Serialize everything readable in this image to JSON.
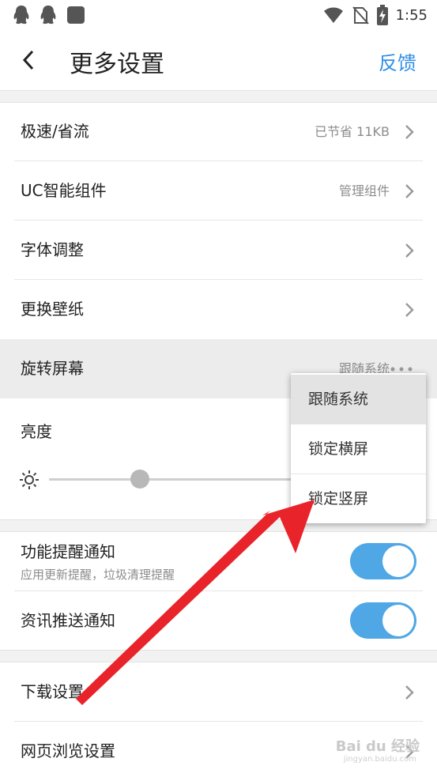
{
  "status_bar": {
    "time": "1:55",
    "left_icons": [
      "qq-icon",
      "qq-icon",
      "app-square-icon"
    ],
    "right_icons": [
      "wifi-icon",
      "no-sim-icon",
      "battery-charging-icon"
    ]
  },
  "header": {
    "title": "更多设置",
    "feedback": "反馈"
  },
  "settings": {
    "speed": {
      "label": "极速/省流",
      "value": "已节省 11KB"
    },
    "widget": {
      "label": "UC智能组件",
      "value": "管理组件"
    },
    "font": {
      "label": "字体调整"
    },
    "wallpaper": {
      "label": "更换壁纸"
    },
    "rotate": {
      "label": "旋转屏幕",
      "value": "跟随系统"
    },
    "brightness": {
      "label": "亮度",
      "level_fraction": 0.36
    },
    "feature_notify": {
      "label": "功能提醒通知",
      "subtitle": "应用更新提醒，垃圾清理提醒",
      "enabled": true
    },
    "news_notify": {
      "label": "资讯推送通知",
      "enabled": true
    },
    "download": {
      "label": "下载设置"
    },
    "browse": {
      "label": "网页浏览设置"
    }
  },
  "rotate_menu": {
    "options": [
      "跟随系统",
      "锁定横屏",
      "锁定竖屏"
    ],
    "selected": "跟随系统"
  },
  "colors": {
    "accent": "#2f8fe6",
    "toggle_on": "#4fa7e6",
    "arrow_annotation": "#e8232a"
  },
  "watermark": {
    "text": "Bai du 经验",
    "sub": "jingyan.baidu.com"
  }
}
